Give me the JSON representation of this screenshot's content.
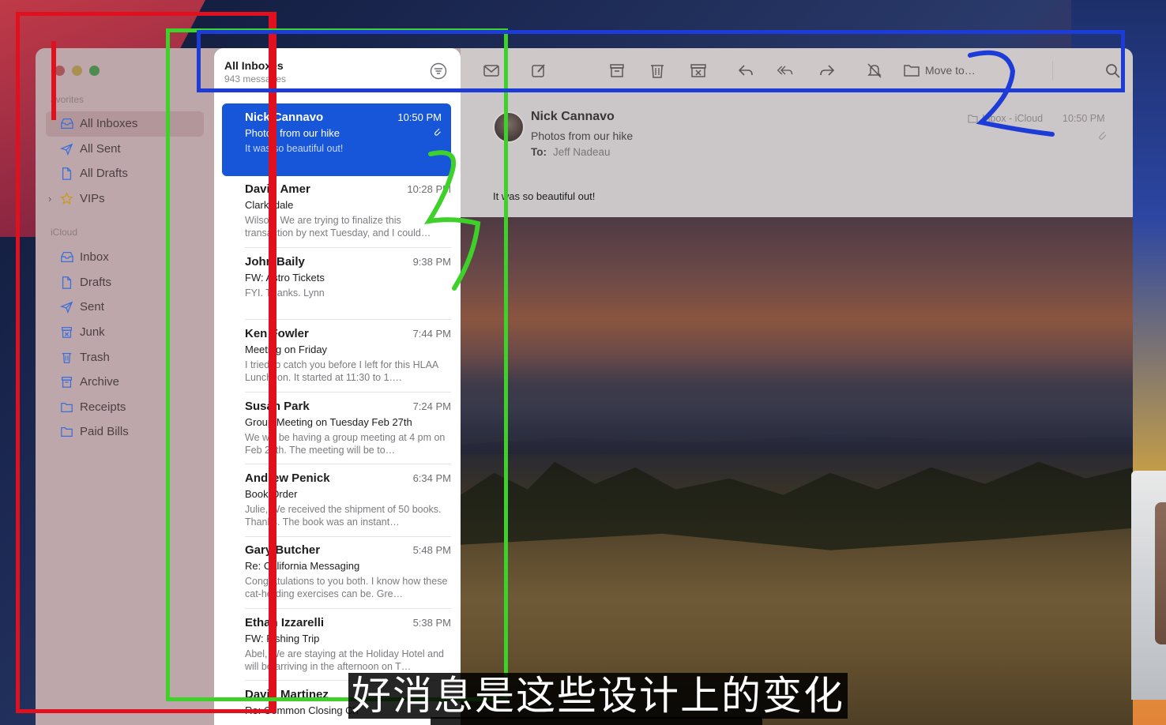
{
  "window": {
    "sidebar": {
      "favorites_header": "avorites",
      "favorites": [
        {
          "label": "All Inboxes",
          "icon": "tray-icon",
          "active": true
        },
        {
          "label": "All Sent",
          "icon": "paperplane-icon"
        },
        {
          "label": "All Drafts",
          "icon": "document-icon"
        },
        {
          "label": "VIPs",
          "icon": "star-icon"
        }
      ],
      "icloud_header": "iCloud",
      "icloud": [
        {
          "label": "Inbox",
          "icon": "tray-icon"
        },
        {
          "label": "Drafts",
          "icon": "document-icon"
        },
        {
          "label": "Sent",
          "icon": "paperplane-icon"
        },
        {
          "label": "Junk",
          "icon": "junk-icon"
        },
        {
          "label": "Trash",
          "icon": "trash-icon"
        },
        {
          "label": "Archive",
          "icon": "archive-icon"
        },
        {
          "label": "Receipts",
          "icon": "folder-icon"
        },
        {
          "label": "Paid Bills",
          "icon": "folder-icon"
        }
      ]
    },
    "message_list": {
      "title": "All Inboxes",
      "subtitle": "943 messages",
      "messages": [
        {
          "from": "Nick Cannavo",
          "time": "10:50 PM",
          "subject": "Photos from our hike",
          "preview": "It was so beautiful out!",
          "attachment": true
        },
        {
          "from": "David Amer",
          "time": "10:28 PM",
          "subject": "Clarksdale",
          "preview": "Wilson, We are trying to finalize this transaction by next Tuesday, and I could…"
        },
        {
          "from": "John Baily",
          "time": "9:38 PM",
          "subject": "FW: Astro Tickets",
          "preview": "FYI. Thanks. Lynn"
        },
        {
          "from": "Ken Fowler",
          "time": "7:44 PM",
          "subject": "Meeting on Friday",
          "preview": "I tried to catch you before I left for this HLAA Luncheon. It started at 11:30 to 1…."
        },
        {
          "from": "Susan Park",
          "time": "7:24 PM",
          "subject": "Group Meeting on Tuesday Feb 27th",
          "preview": "We will be having a group meeting at 4 pm on Feb 27th. The meeting will be to…"
        },
        {
          "from": "Andrew Penick",
          "time": "6:34 PM",
          "subject": "Book Order",
          "preview": "Julie, We received the shipment of 50 books. Thanks. The book was an instant…"
        },
        {
          "from": "Gary Butcher",
          "time": "5:48 PM",
          "subject": "Re: California Messaging",
          "preview": "Congratulations to you both. I know how these cat-herding exercises can be. Gre…"
        },
        {
          "from": "Ethan Izzarelli",
          "time": "5:38 PM",
          "subject": "FW: Fishing Trip",
          "preview": "Abel, We are staying at the Holiday Hotel and will be arriving in the afternoon on T…"
        },
        {
          "from": "David Martinez",
          "time": "",
          "subject": "Re: Common Closing Ch",
          "preview": ""
        }
      ]
    },
    "toolbar": {
      "move_to": "Move to…"
    },
    "message": {
      "from": "Nick Cannavo",
      "subject": "Photos from our hike",
      "to_label": "To:",
      "to_name": "Jeff Nadeau",
      "mailbox": "Inbox - iCloud",
      "time": "10:50 PM",
      "body": "It was so beautiful out!"
    }
  },
  "annotations": {
    "labels": [
      "1",
      "2",
      "3"
    ],
    "colors": {
      "red": "#e0101f",
      "green": "#3ed12a",
      "blue": "#1d3bd6"
    }
  },
  "subtitle": "好消息是这些设计上的变化",
  "colors": {
    "accent": "#1756d9",
    "sidebar": "#bda7aa"
  }
}
